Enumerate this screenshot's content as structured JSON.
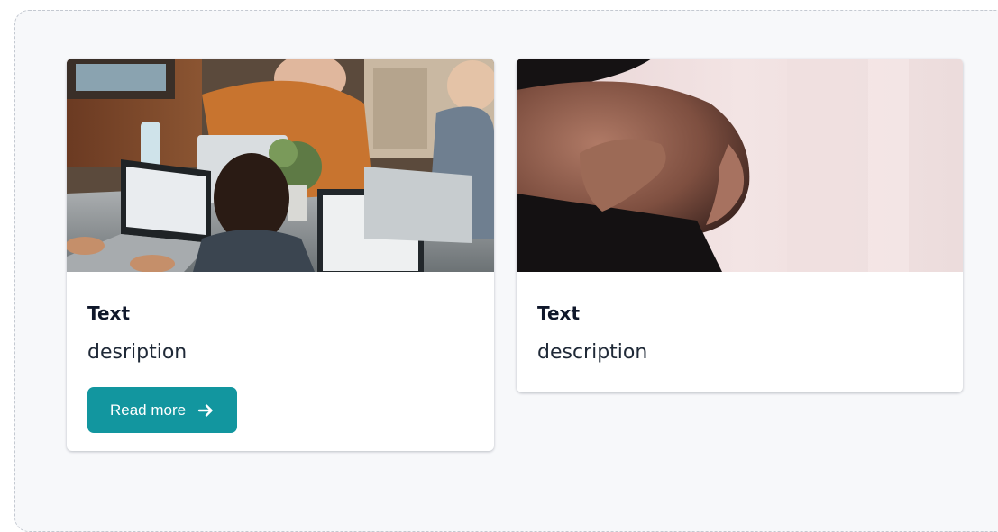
{
  "cards": [
    {
      "title": "Text",
      "description": "desrip­tion",
      "button_label": "Read more",
      "button_icon": "arrow-right-icon",
      "image": "people-working-laptops-photo"
    },
    {
      "title": "Text",
      "description": "description",
      "image": "pregnant-belly-photo"
    }
  ],
  "colors": {
    "accent": "#12969f",
    "background": "#f7f8fa",
    "card": "#ffffff",
    "title_text": "#0f172a"
  }
}
